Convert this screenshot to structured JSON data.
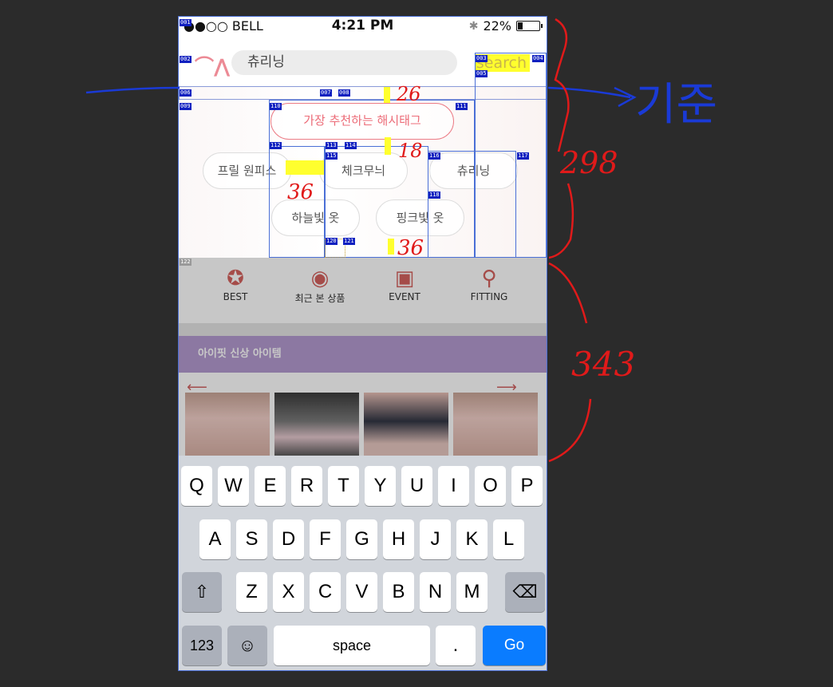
{
  "status_bar": {
    "carrier": "●●○○ BELL",
    "time": "4:21 PM",
    "battery": "22%",
    "battery_level": 0.22
  },
  "search": {
    "value": "츄리닝",
    "button": "search"
  },
  "hashtags": {
    "title": "가장 추천하는 해시태그",
    "tags": [
      "프릴 원피스",
      "체크무늬",
      "츄리닝",
      "하늘빛 옷",
      "핑크빛 옷"
    ]
  },
  "menu": [
    {
      "label": "BEST",
      "icon": "ribbon-badge-icon"
    },
    {
      "label": "최근 본 상품",
      "icon": "eye-icon"
    },
    {
      "label": "EVENT",
      "icon": "gift-icon"
    },
    {
      "label": "FITTING",
      "icon": "magnifier-hanger-icon"
    }
  ],
  "new_items": {
    "title": "아이핏 신상 아이템"
  },
  "annotations": {
    "top_margin": "26",
    "gap_mid": "18",
    "gap_side": "36",
    "gap_bottom": "36",
    "section_top": "298",
    "section_bottom": "343",
    "baseline": "기준"
  },
  "guide_labels": [
    "001",
    "002",
    "003",
    "004",
    "005",
    "006",
    "007",
    "008",
    "009",
    "110",
    "111",
    "112",
    "113",
    "114",
    "115",
    "116",
    "117",
    "118",
    "120",
    "121",
    "122"
  ],
  "keyboard": {
    "row1": [
      "Q",
      "W",
      "E",
      "R",
      "T",
      "Y",
      "U",
      "I",
      "O",
      "P"
    ],
    "row2": [
      "A",
      "S",
      "D",
      "F",
      "G",
      "H",
      "J",
      "K",
      "L"
    ],
    "row3": [
      "Z",
      "X",
      "C",
      "V",
      "B",
      "N",
      "M"
    ],
    "numbers": "123",
    "space": "space",
    "period": ".",
    "go": "Go"
  },
  "colors": {
    "accent_pink": "#ec6c78",
    "purple_bar": "#b49ad0",
    "go_blue": "#0a7cff",
    "highlight": "#ffff2e",
    "annotation_red": "#e01a1a",
    "guide_blue": "#4a6fd6"
  }
}
